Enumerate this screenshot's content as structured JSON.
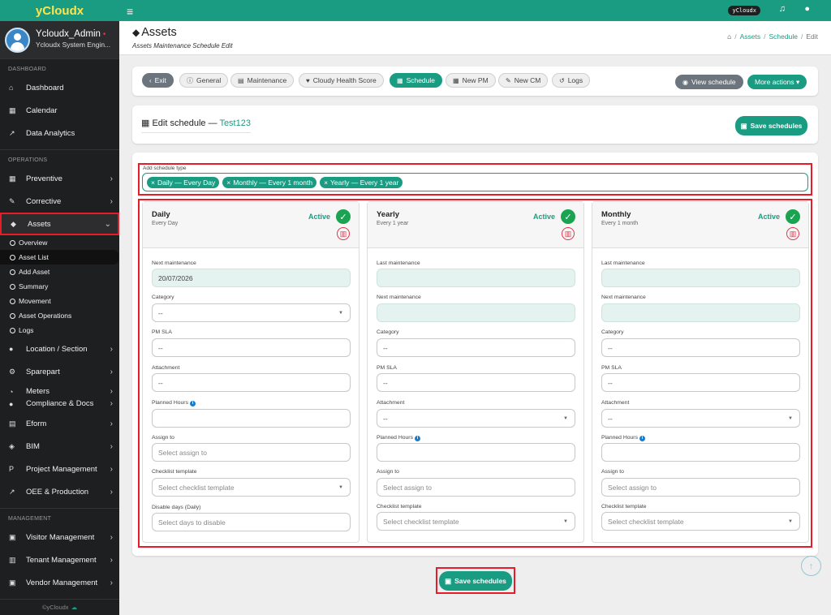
{
  "brand": "yCloudx",
  "profile": {
    "name": "Ycloudx_Admin",
    "role": "Ycloudx System Engin...",
    "status_dot": "•"
  },
  "sidebar": {
    "sections": {
      "dashboard": "DASHBOARD",
      "operations": "OPERATIONS",
      "management": "MANAGEMENT"
    },
    "items": {
      "dashboard": "Dashboard",
      "calendar": "Calendar",
      "data_analytics": "Data Analytics",
      "preventive": "Preventive",
      "corrective": "Corrective",
      "assets": "Assets",
      "location": "Location / Section",
      "sparepart": "Sparepart",
      "meters": "Meters",
      "compliance": "Compliance & Docs",
      "eform": "Eform",
      "bim": "BIM",
      "project": "Project Management",
      "oee": "OEE & Production",
      "visitor": "Visitor Management",
      "tenant": "Tenant Management",
      "vendor": "Vendor Management"
    },
    "asset_sub": {
      "overview": "Overview",
      "asset_list": "Asset List",
      "add_asset": "Add Asset",
      "summary": "Summary",
      "movement": "Movement",
      "asset_operations": "Asset Operations",
      "logs": "Logs"
    },
    "footer": "©yCloudx"
  },
  "topbar": {
    "chip": "yCloudx"
  },
  "header": {
    "title": "Assets",
    "subtitle": "Assets Maintenance Schedule Edit",
    "breadcrumb": {
      "assets": "Assets",
      "schedule": "Schedule",
      "edit": "Edit",
      "sep": "/"
    }
  },
  "toolbar": {
    "exit": "Exit",
    "general": "General",
    "maintenance": "Maintenance",
    "health": "Cloudy Health Score",
    "schedule": "Schedule",
    "new_pm": "New PM",
    "new_cm": "New CM",
    "logs": "Logs",
    "view_schedule": "View schedule",
    "more_actions": "More actions ▾"
  },
  "edit": {
    "title": "Edit schedule —",
    "name": "Test123",
    "save": "Save schedules"
  },
  "schedule_type": {
    "label": "Add schedule type",
    "chips": [
      "Daily — Every Day",
      "Monthly — Every 1 month",
      "Yearly — Every 1 year"
    ]
  },
  "columns": {
    "daily": {
      "name": "Daily",
      "freq": "Every Day",
      "status": "Active",
      "next_maint_label": "Next maintenance",
      "next_maint_value": "20/07/2026",
      "category_label": "Category",
      "category_value": "--",
      "pmsla_label": "PM SLA",
      "pmsla_value": "--",
      "attachment_label": "Attachment",
      "attachment_value": "--",
      "planned_label": "Planned Hours",
      "planned_value": "",
      "assign_label": "Assign to",
      "assign_ph": "Select assign to",
      "checklist_label": "Checklist template",
      "checklist_ph": "Select checklist template",
      "disable_label": "Disable days (Daily)",
      "disable_ph": "Select days to disable"
    },
    "yearly": {
      "name": "Yearly",
      "freq": "Every 1 year",
      "status": "Active",
      "last_maint_label": "Last maintenance",
      "last_maint_value": "",
      "next_maint_label": "Next maintenance",
      "next_maint_value": "",
      "category_label": "Category",
      "category_value": "--",
      "pmsla_label": "PM SLA",
      "pmsla_value": "--",
      "attachment_label": "Attachment",
      "attachment_value": "--",
      "planned_label": "Planned Hours",
      "planned_value": "",
      "assign_label": "Assign to",
      "assign_ph": "Select assign to",
      "checklist_label": "Checklist template",
      "checklist_ph": "Select checklist template"
    },
    "monthly": {
      "name": "Monthly",
      "freq": "Every 1 month",
      "status": "Active",
      "last_maint_label": "Last maintenance",
      "last_maint_value": "",
      "next_maint_label": "Next maintenance",
      "next_maint_value": "",
      "category_label": "Category",
      "category_value": "--",
      "pmsla_label": "PM SLA",
      "pmsla_value": "--",
      "attachment_label": "Attachment",
      "attachment_value": "--",
      "planned_label": "Planned Hours",
      "planned_value": "",
      "assign_label": "Assign to",
      "assign_ph": "Select assign to",
      "checklist_label": "Checklist template",
      "checklist_ph": "Select checklist template"
    }
  },
  "bottom": {
    "save": "Save schedules"
  },
  "colors": {
    "accent": "#1a9c82",
    "brand_text": "#ffe44a",
    "highlight": "#e81c28",
    "sidebar_bg": "#1e1f21",
    "active_green": "#1aa350"
  }
}
